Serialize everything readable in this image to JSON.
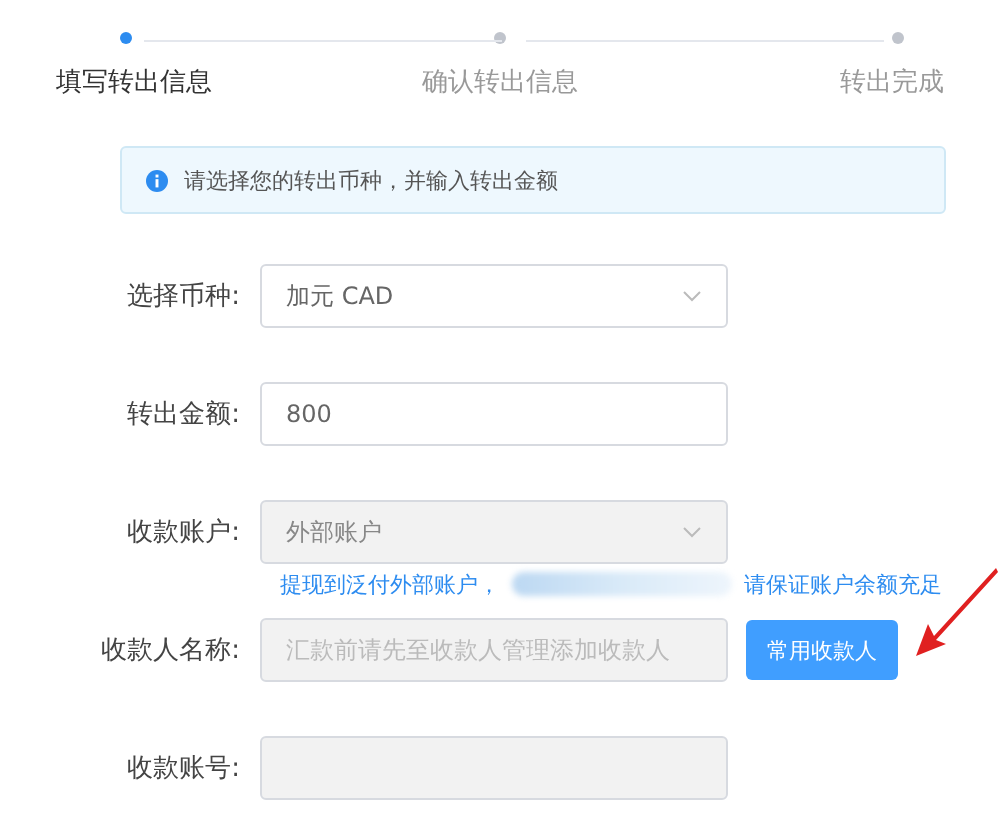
{
  "steps": [
    {
      "label": "填写转出信息",
      "selected": true
    },
    {
      "label": "确认转出信息",
      "selected": false
    },
    {
      "label": "转出完成",
      "selected": false
    }
  ],
  "alert": {
    "text": "请选择您的转出币种，并输入转出金额"
  },
  "fields": [
    {
      "label": "选择币种:",
      "kind": "select",
      "value": "加元 CAD",
      "disabled": false
    },
    {
      "label": "转出金额:",
      "kind": "input",
      "value": "800",
      "disabled": false
    },
    {
      "label": "收款账户:",
      "kind": "select",
      "value": "外部账户",
      "disabled": true,
      "note": {
        "before": "提现到泛付外部账户，",
        "after": "请保证账户余额充足"
      }
    },
    {
      "label": "收款人名称:",
      "kind": "input",
      "placeholder": "汇款前请先至收款人管理添加收款人",
      "disabled": true,
      "action": "常用收款人"
    },
    {
      "label": "收款账号:",
      "kind": "input",
      "disabled": true
    }
  ]
}
